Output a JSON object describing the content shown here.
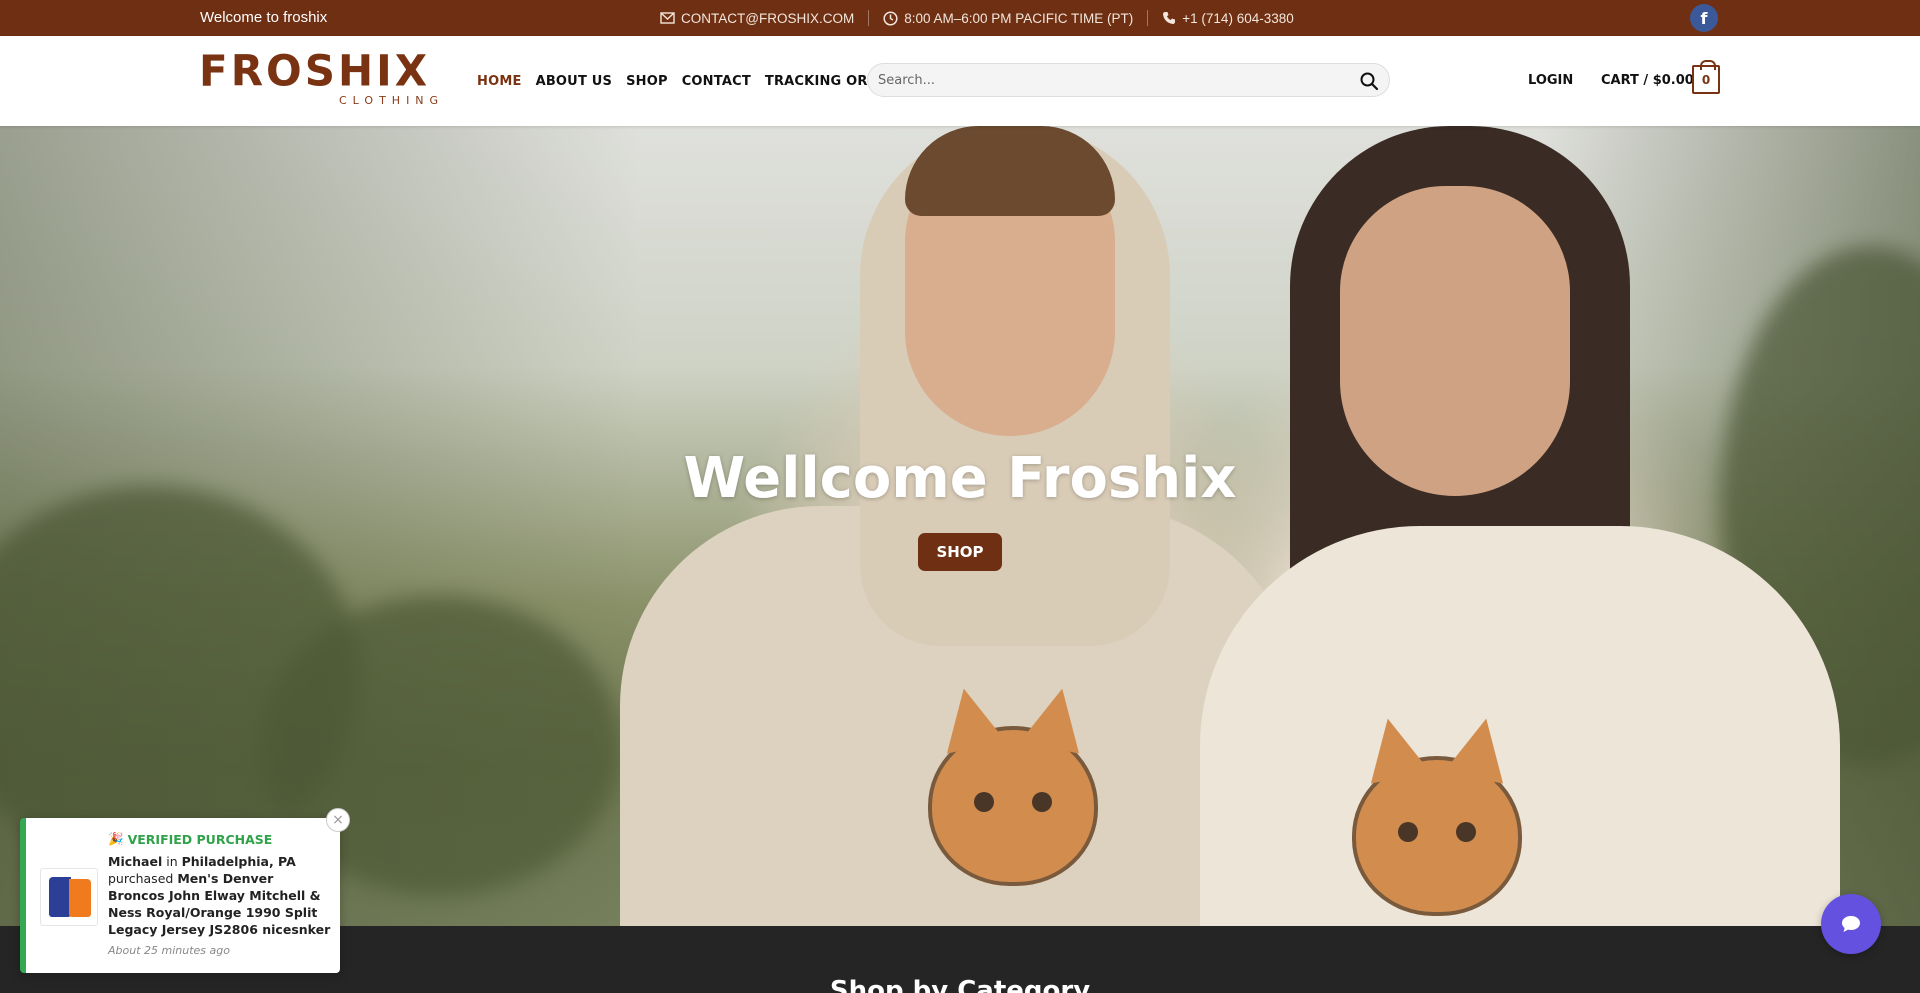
{
  "topbar": {
    "welcome": "Welcome to froshix",
    "email": "CONTACT@FROSHIX.COM",
    "hours": "8:00 AM–6:00 PM PACIFIC TIME (PT)",
    "phone": "+1 (714) 604-3380",
    "facebook_icon": "f"
  },
  "header": {
    "logo_text": "FROSHIX",
    "logo_sub": "CLOTHING",
    "nav": [
      {
        "label": "HOME",
        "active": true
      },
      {
        "label": "ABOUT US",
        "active": false
      },
      {
        "label": "SHOP",
        "active": false
      },
      {
        "label": "CONTACT",
        "active": false
      },
      {
        "label": "TRACKING ORDER",
        "active": false
      }
    ],
    "search_placeholder": "Search...",
    "login": "LOGIN",
    "cart_label": "CART / $0.00",
    "cart_count": "0"
  },
  "hero": {
    "title": "Wellcome Froshix",
    "button": "SHOP"
  },
  "section": {
    "heading": "Shop by Category"
  },
  "popup": {
    "badge": "VERIFIED PURCHASE",
    "buyer": "Michael",
    "in_word": "in",
    "location": "Philadelphia, PA",
    "purchased_word": "purchased",
    "product": "Men's Denver Broncos John Elway Mitchell & Ness Royal/Orange 1990 Split Legacy Jersey JS2806 nicesnker",
    "time": "About 25 minutes ago",
    "close": "×"
  },
  "colors": {
    "brand": "#6e2f12",
    "verified": "#2fa24a",
    "chat": "#6451e0"
  }
}
